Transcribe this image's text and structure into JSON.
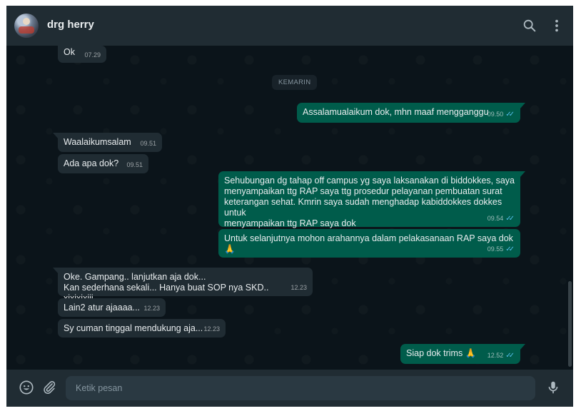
{
  "header": {
    "contact_name": "drg herry",
    "icons": [
      "avatar",
      "search-icon",
      "menu-icon"
    ]
  },
  "chat": {
    "date_separator": "KEMARIN",
    "messages": [
      {
        "dir": "in",
        "text": "Ok",
        "time": "07.29"
      },
      {
        "dir": "out",
        "text": "Assalamualaikum dok, mhn maaf mengganggu",
        "time": "09.50",
        "ticks": "read"
      },
      {
        "dir": "in",
        "text": "Waalaikumsalam",
        "time": "09.51"
      },
      {
        "dir": "in",
        "text": "Ada apa dok?",
        "time": "09.51"
      },
      {
        "dir": "out",
        "text": "Sehubungan dg tahap off campus yg saya laksanakan di biddokkes, saya\nmenyampaikan ttg RAP saya ttg prosedur pelayanan pembuatan surat\nketerangan sehat. Kmrin saya sudah menghadap kabiddokkes dokkes untuk\nmenyampaikan ttg RAP saya dok",
        "time": "09.54",
        "ticks": "read"
      },
      {
        "dir": "out",
        "text": "Untuk selanjutnya mohon arahannya dalam pelakasanaan RAP saya dok 🙏",
        "time": "09.55",
        "ticks": "read"
      },
      {
        "dir": "in",
        "text": "Oke. Gampang.. lanjutkan aja dok...\nKan sederhana sekali... Hanya buat SOP nya SKD.. xixixixiii...",
        "time": "12.23"
      },
      {
        "dir": "in",
        "text": "Lain2 atur ajaaaa...",
        "time": "12.23"
      },
      {
        "dir": "in",
        "text": "Sy cuman tinggal mendukung aja...",
        "time": "12.23"
      },
      {
        "dir": "out",
        "text": "Siap dok trims 🙏",
        "time": "12.52",
        "ticks": "read"
      }
    ]
  },
  "footer": {
    "input_placeholder": "Ketik pesan",
    "input_value": "",
    "icons": [
      "emoji-icon",
      "attach-icon",
      "mic-icon"
    ]
  },
  "colors": {
    "background": "#0b141a",
    "header": "#202c33",
    "incoming_bubble": "#202c33",
    "outgoing_bubble": "#005c4b",
    "read_ticks": "#53bdeb",
    "icon": "#aebac1"
  }
}
